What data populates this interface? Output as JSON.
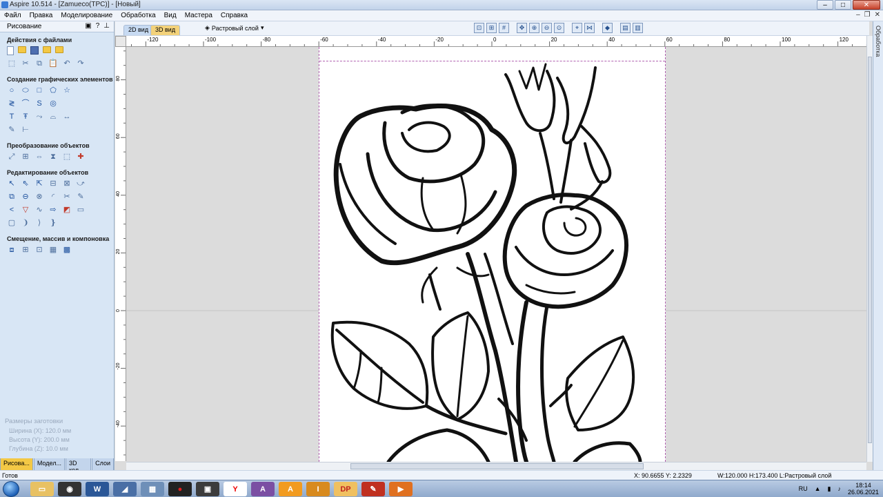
{
  "window": {
    "title": "Aspire 10.514 - [Zamueco(TPC)] - [Новый]"
  },
  "menu": [
    "Файл",
    "Правка",
    "Моделирование",
    "Обработка",
    "Вид",
    "Мастера",
    "Справка"
  ],
  "left_panel": {
    "title": "Рисование",
    "sections": [
      {
        "title": "Действия с файлами"
      },
      {
        "title": "Создание графических элементов"
      },
      {
        "title": "Преобразование объектов"
      },
      {
        "title": "Редактирование объектов"
      },
      {
        "title": "Смещение, массив и компоновка"
      }
    ],
    "stock": {
      "heading": "Размеры заготовки",
      "width": "Ширина  (X): 120.0 мм",
      "height": "Высота  (Y): 200.0 мм",
      "depth": "Глубина (Z): 10.0 мм"
    },
    "bottom_tabs": [
      "Рисова...",
      "Модел...",
      "3D кол...",
      "Слои"
    ]
  },
  "view_tabs": {
    "tab_2d": "2D вид",
    "tab_3d": "3D вид"
  },
  "layer_select": "Растровый слой",
  "ruler_h_labels": [
    "-120",
    "-100",
    "-80",
    "-60",
    "-40",
    "-20",
    "0",
    "20",
    "40",
    "60",
    "80",
    "100",
    "120"
  ],
  "ruler_v_labels": [
    "80",
    "60",
    "40",
    "20",
    "0",
    "-20",
    "-40"
  ],
  "right_strip_label": "Обработка",
  "status": {
    "ready": "Готов",
    "coords": "X: 90.6655 Y: 2.2329",
    "size": "W:120.000  H:173.400  L:Растровый слой"
  },
  "taskbar": {
    "lang": "RU",
    "time": "18:14",
    "date": "26.06.2021"
  }
}
